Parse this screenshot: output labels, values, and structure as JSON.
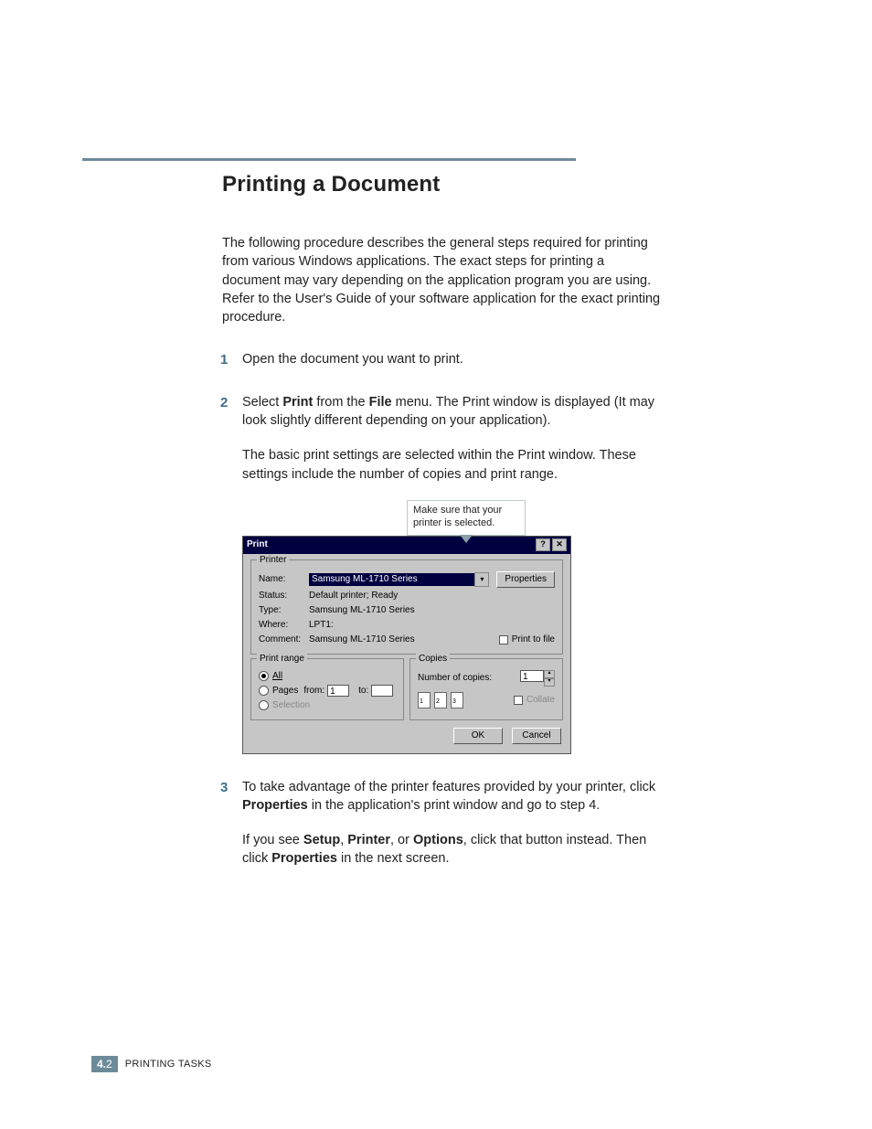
{
  "section_title": "Printing a Document",
  "intro": "The following procedure describes the general steps required for printing from various Windows applications. The exact steps for printing a document may vary depending on the application program you are using. Refer to the User's Guide of your software application for the exact printing procedure.",
  "steps": {
    "n1": "1",
    "s1": "Open the document you want to print.",
    "n2": "2",
    "s2a_pre": "Select ",
    "s2a_print": "Print",
    "s2a_mid": " from the ",
    "s2a_file": "File",
    "s2a_post": " menu. The Print window is displayed (It may look slightly different depending on your application).",
    "s2b": "The basic print settings are selected within the Print window. These settings include the number of copies and print range.",
    "n3": "3",
    "s3a_pre": "To take advantage of the printer features provided by your printer, click ",
    "s3a_prop": "Properties",
    "s3a_post": " in the application's print window and go to step 4.",
    "s3b_pre": "If you see ",
    "s3b_setup": "Setup",
    "s3b_sep1": ", ",
    "s3b_printer": "Printer",
    "s3b_sep2": ", or ",
    "s3b_options": "Options",
    "s3b_mid": ", click that button instead. Then click ",
    "s3b_prop": "Properties",
    "s3b_post": " in the next screen."
  },
  "callout": "Make sure that your printer is selected.",
  "dialog": {
    "title": "Print",
    "help_btn": "?",
    "close_btn": "✕",
    "printer_group": "Printer",
    "name_lbl": "Name:",
    "name_val": "Samsung ML-1710 Series",
    "properties_btn": "Properties",
    "status_lbl": "Status:",
    "status_val": "Default printer; Ready",
    "type_lbl": "Type:",
    "type_val": "Samsung ML-1710 Series",
    "where_lbl": "Where:",
    "where_val": "LPT1:",
    "comment_lbl": "Comment:",
    "comment_val": "Samsung ML-1710 Series",
    "print_to_file": "Print to file",
    "range_group": "Print range",
    "range_all": "All",
    "range_pages": "Pages",
    "range_from": "from:",
    "range_from_val": "1",
    "range_to": "to:",
    "range_to_val": "",
    "range_selection": "Selection",
    "copies_group": "Copies",
    "copies_lbl": "Number of copies:",
    "copies_val": "1",
    "collate": "Collate",
    "col_p1": "1",
    "col_p2": "2",
    "col_p3": "3",
    "ok_btn": "OK",
    "cancel_btn": "Cancel"
  },
  "footer": {
    "chip_a": "4.",
    "chip_b": "2",
    "label": "Printing Tasks"
  }
}
